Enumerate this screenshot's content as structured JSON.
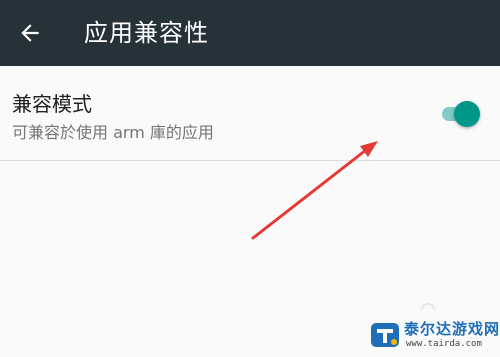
{
  "appbar": {
    "title": "应用兼容性",
    "back_icon": "arrow-left-icon",
    "background": "#263238"
  },
  "setting": {
    "title": "兼容模式",
    "summary": "可兼容於使用 arm 庫的应用",
    "toggle_on": true,
    "accent": "#009688"
  },
  "annotation": {
    "arrow_color": "#e53935"
  },
  "watermark": {
    "name": "泰尔达游戏网",
    "url": "www.tairda.com",
    "icon": "tairda-logo-icon"
  }
}
